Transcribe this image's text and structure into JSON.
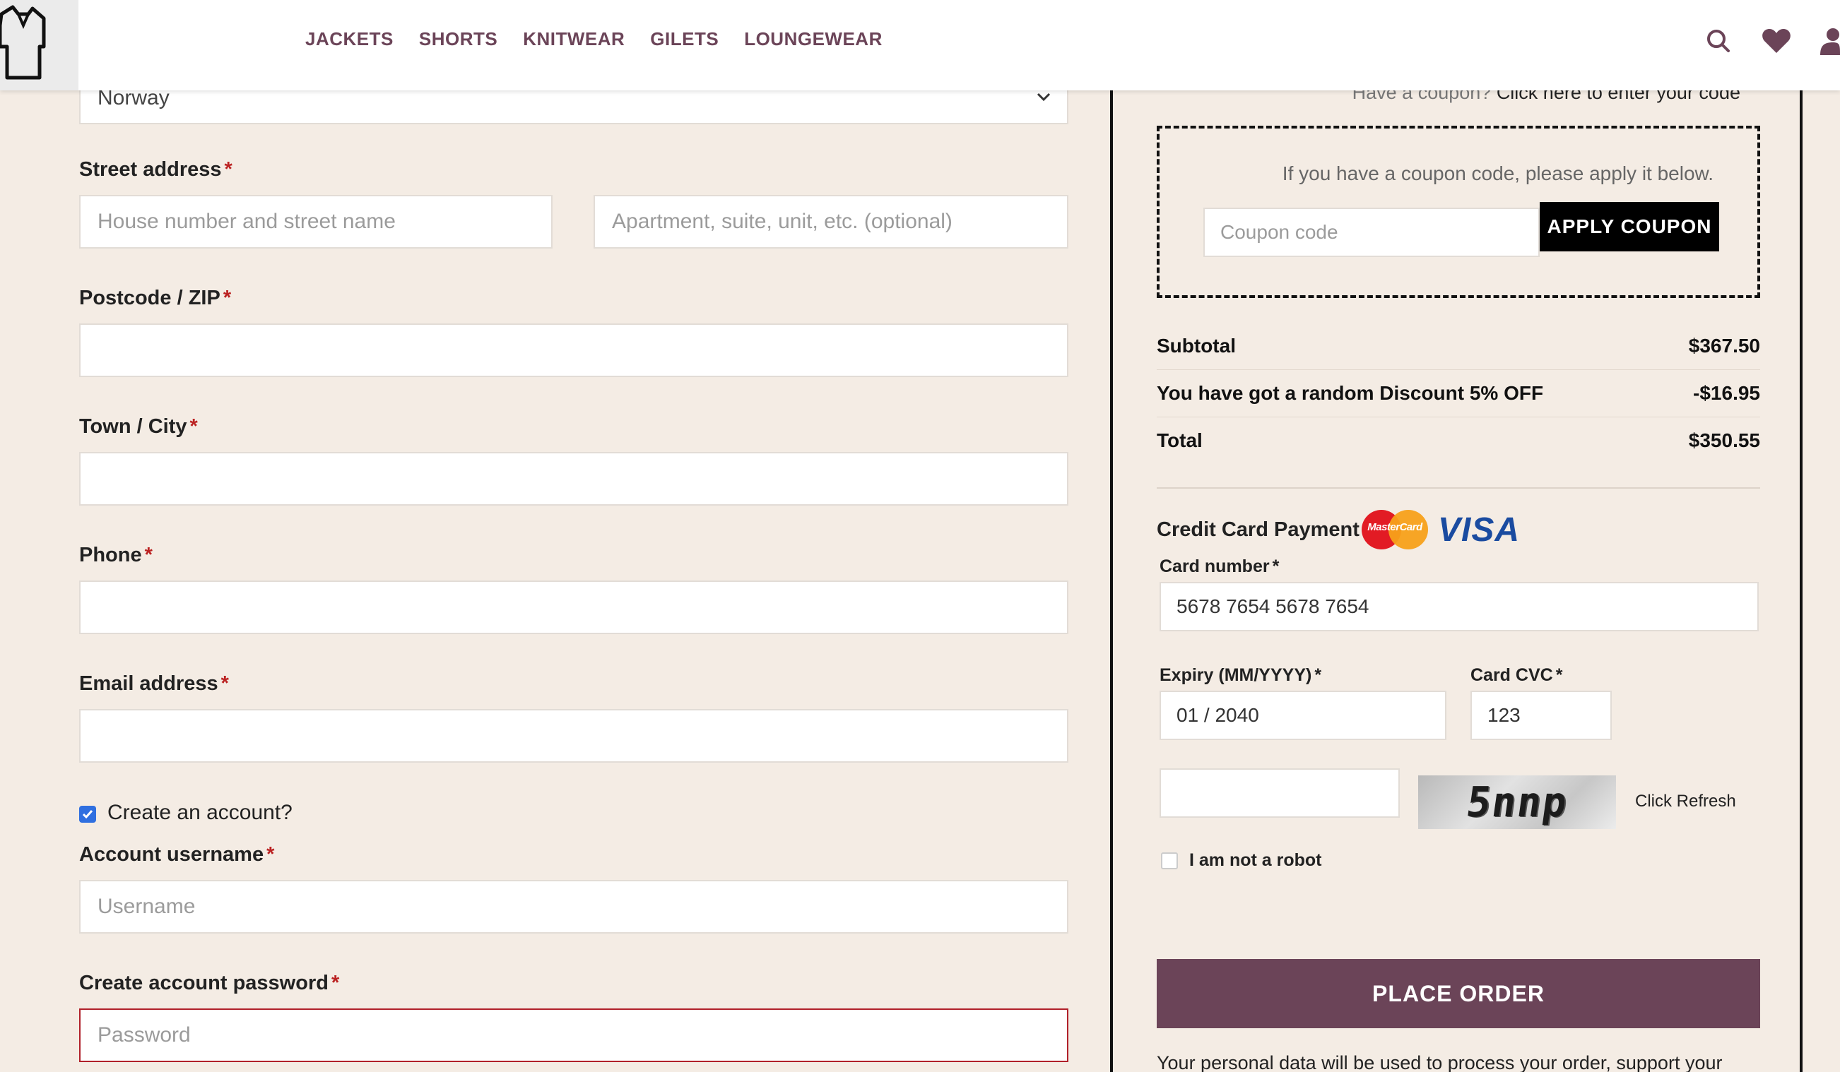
{
  "nav": {
    "items": [
      "JACKETS",
      "SHORTS",
      "KNITWEAR",
      "GILETS",
      "LOUNGEWEAR"
    ]
  },
  "icons": {
    "logo": "shirt-logo-icon",
    "search": "search-icon",
    "wishlist": "heart-icon",
    "account": "user-icon"
  },
  "colors": {
    "brand": "#6b4458",
    "background": "#f4ece4",
    "error": "#b0202a",
    "checkbox": "#2f6fe0"
  },
  "billing": {
    "country_value": "Norway",
    "street_label": "Street address",
    "street_placeholder": "House number and street name",
    "apartment_placeholder": "Apartment, suite, unit, etc. (optional)",
    "postcode_label": "Postcode / ZIP",
    "city_label": "Town / City",
    "phone_label": "Phone",
    "email_label": "Email address",
    "create_account_label": "Create an account?",
    "create_account_checked": true,
    "username_label": "Account username",
    "username_placeholder": "Username",
    "password_label": "Create account password",
    "password_placeholder": "Password",
    "required_mark": "*"
  },
  "coupon": {
    "prompt": "Have a coupon?",
    "link": "Click here to enter your code",
    "message": "If you have a coupon code, please apply it below.",
    "placeholder": "Coupon code",
    "button": "APPLY COUPON"
  },
  "totals": [
    {
      "label": "Subtotal",
      "value": "$367.50"
    },
    {
      "label": "You have got a random Discount 5% OFF",
      "value": "-$16.95"
    },
    {
      "label": "Total",
      "value": "$350.55"
    }
  ],
  "payment": {
    "title": "Credit Card Payment",
    "mastercard_text": "MasterCard",
    "visa_text": "VISA",
    "card_number_label": "Card number",
    "card_number_value": "5678 7654 5678 7654",
    "expiry_label": "Expiry (MM/YYYY)",
    "expiry_value": "01 / 2040",
    "cvc_label": "Card CVC",
    "cvc_value": "123",
    "captcha_text": "5nnp",
    "refresh_label": "Click Refresh",
    "robot_label": "I am not a robot"
  },
  "place_order": "PLACE ORDER",
  "privacy_text": "Your personal data will be used to process your order, support your"
}
